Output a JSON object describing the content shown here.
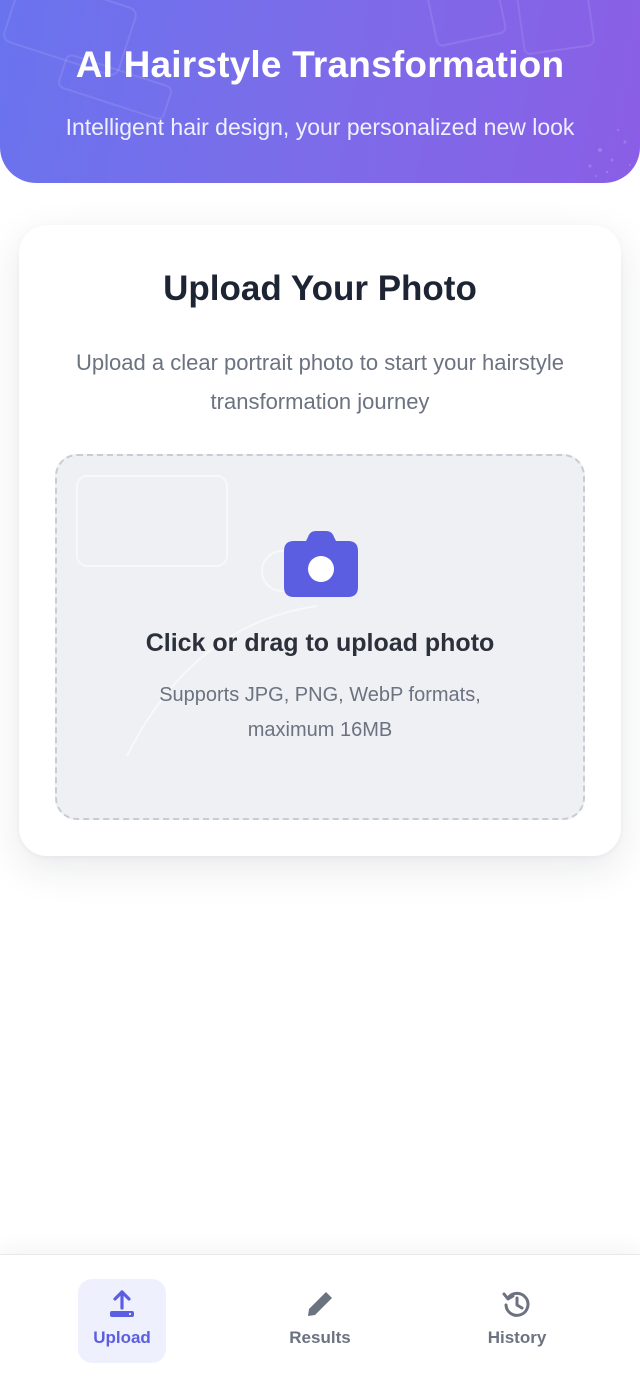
{
  "header": {
    "title": "AI Hairstyle Transformation",
    "subtitle": "Intelligent hair design, your personalized new look"
  },
  "upload_card": {
    "title": "Upload Your Photo",
    "description": "Upload a clear portrait photo to start your hairstyle transformation journey",
    "dropzone": {
      "title": "Click or drag to upload photo",
      "hint": "Supports JPG, PNG, WebP formats, maximum 16MB",
      "icon": "camera-icon"
    }
  },
  "bottom_nav": {
    "items": [
      {
        "label": "Upload",
        "icon": "upload-icon",
        "active": true
      },
      {
        "label": "Results",
        "icon": "pencil-icon",
        "active": false
      },
      {
        "label": "History",
        "icon": "history-icon",
        "active": false
      }
    ]
  },
  "colors": {
    "header_gradient_start": "#6a73ee",
    "header_gradient_end": "#8a5ee6",
    "accent": "#5b5ee0",
    "active_nav_bg": "#eef0fe",
    "dropzone_bg": "#eef0f4"
  }
}
